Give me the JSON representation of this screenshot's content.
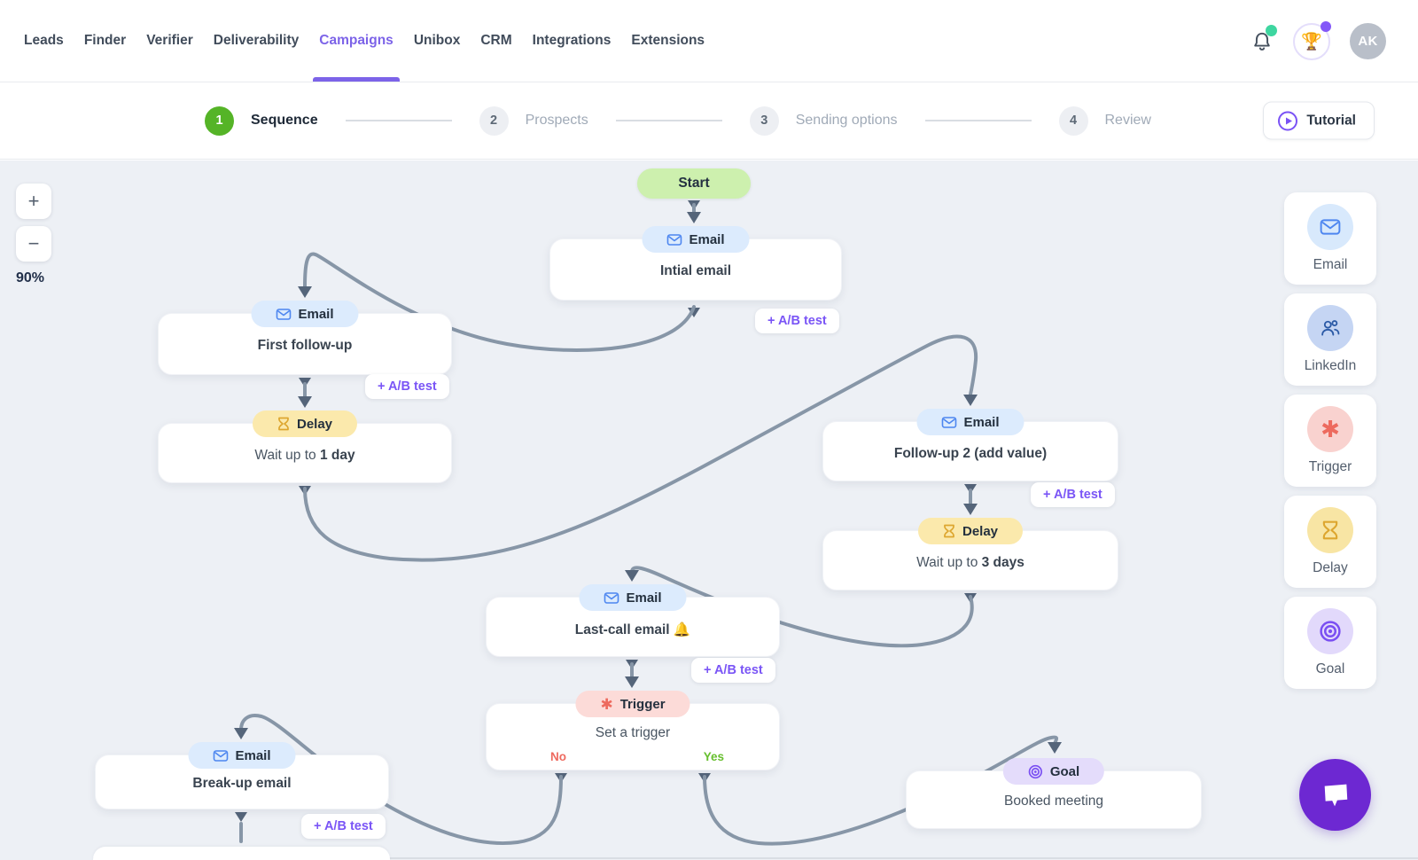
{
  "nav": {
    "items": [
      "Leads",
      "Finder",
      "Verifier",
      "Deliverability",
      "Campaigns",
      "Unibox",
      "CRM",
      "Integrations",
      "Extensions"
    ],
    "active_item": "Campaigns",
    "avatar_initials": "AK"
  },
  "stepper": {
    "steps": [
      {
        "num": "1",
        "label": "Sequence"
      },
      {
        "num": "2",
        "label": "Prospects"
      },
      {
        "num": "3",
        "label": "Sending options"
      },
      {
        "num": "4",
        "label": "Review"
      }
    ],
    "active_step": "Sequence",
    "tutorial_label": "Tutorial"
  },
  "canvas": {
    "zoom_level": "90%",
    "zoom_in": "+",
    "zoom_out": "−",
    "start_label": "Start",
    "ab_test_label": "+ A/B test",
    "nodes": {
      "intial": {
        "type_label": "Email",
        "title": "Intial email"
      },
      "first_followup": {
        "type_label": "Email",
        "title": "First follow-up"
      },
      "delay1": {
        "type_label": "Delay",
        "prefix": "Wait up to ",
        "duration": "1 day"
      },
      "followup2": {
        "type_label": "Email",
        "title": "Follow-up 2 (add value)"
      },
      "delay3": {
        "type_label": "Delay",
        "prefix": "Wait up to ",
        "duration": "3 days"
      },
      "lastcall": {
        "type_label": "Email",
        "title": "Last-call email 🔔"
      },
      "trigger": {
        "type_label": "Trigger",
        "title": "Set a trigger",
        "no_label": "No",
        "yes_label": "Yes"
      },
      "breakup": {
        "type_label": "Email",
        "title": "Break-up email"
      },
      "goal": {
        "type_label": "Goal",
        "title": "Booked meeting"
      }
    }
  },
  "palette": {
    "items": [
      {
        "label": "Email"
      },
      {
        "label": "LinkedIn"
      },
      {
        "label": "Trigger"
      },
      {
        "label": "Delay"
      },
      {
        "label": "Goal"
      }
    ]
  },
  "colors": {
    "accent_purple": "#7c63e8",
    "step_green": "#55b427",
    "start_green_bg": "#cdf0ae",
    "email_blue_bg": "#dcebfd",
    "delay_yellow_bg": "#fbe9ac",
    "trigger_pink_bg": "#fcdbd8",
    "goal_purple_bg": "#e4dcfb",
    "edge_gray": "#8796a7",
    "no_red": "#ee6a5f",
    "yes_green": "#67bf2e",
    "chat_purple": "#6d28d2"
  }
}
